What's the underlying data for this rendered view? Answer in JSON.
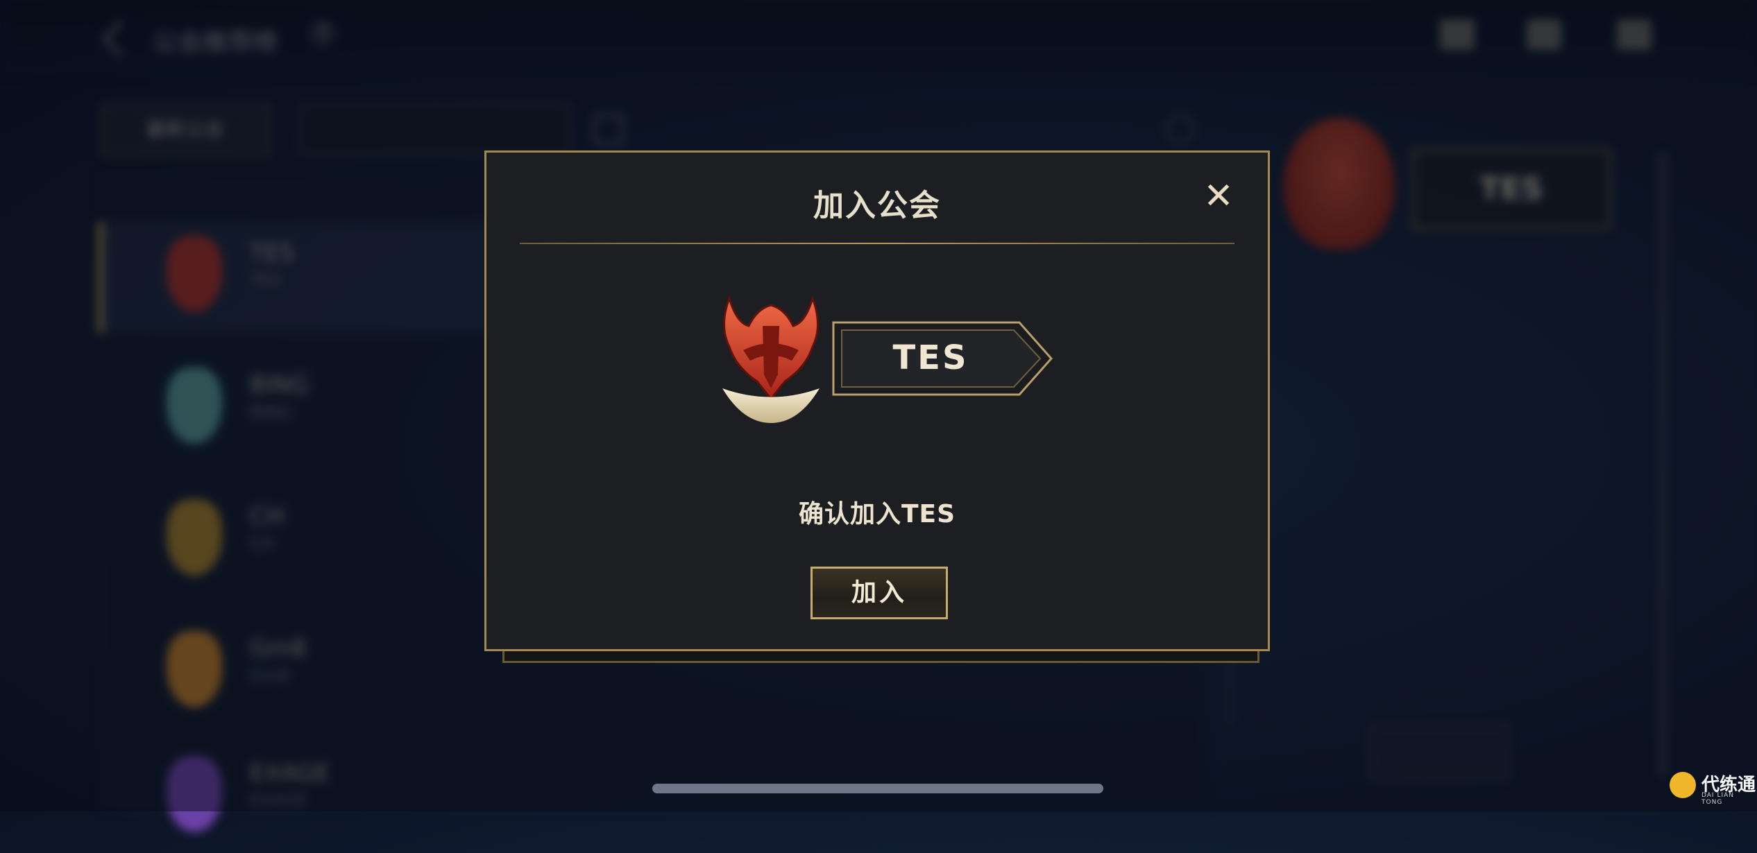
{
  "background": {
    "header": {
      "title": "公会推荐榜"
    },
    "tab_label": "最新公会",
    "list_items": [
      {
        "name": "TES",
        "sub": "TES",
        "color": "#b8342a"
      },
      {
        "name": "BING",
        "sub": "BING",
        "color": "#5fa7a0"
      },
      {
        "name": "CH",
        "sub": "CH",
        "color": "#b68a2c"
      },
      {
        "name": "Gm8",
        "sub": "Gm8",
        "color": "#d68a2a"
      },
      {
        "name": "EXAGE",
        "sub": "EXAGE",
        "color": "#7d4ac0"
      }
    ],
    "right_panel": {
      "guild_name": "TES"
    }
  },
  "modal": {
    "title": "加入公会",
    "close_icon": "close-icon",
    "guild_name": "TES",
    "confirm_text": "确认加入TES",
    "join_label": "加入"
  },
  "watermark": {
    "text": "代练通",
    "sub": "DAI LIAN TONG"
  },
  "colors": {
    "gold": "#a58a50",
    "modal_bg": "#1c1e21",
    "crest_red": "#c9412c"
  }
}
